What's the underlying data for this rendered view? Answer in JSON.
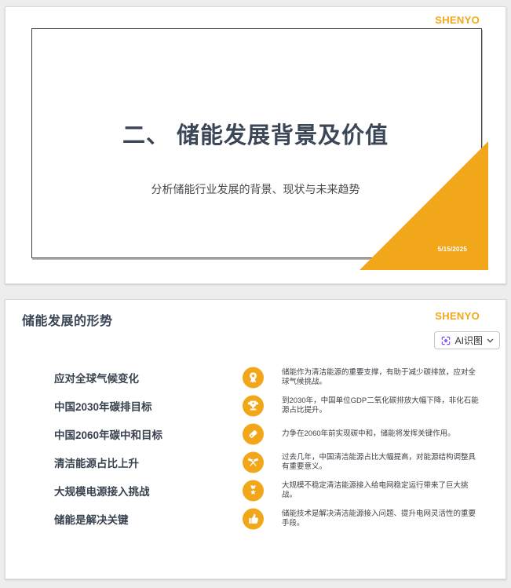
{
  "theme": {
    "accent_color": "#F2A71B",
    "title_color": "#3B4656",
    "page_background": "#EDEDEE"
  },
  "slide1": {
    "logo_text": "SHENYO",
    "title": "二、 储能发展背景及价值",
    "subtitle": "分析储能行业发展的背景、现状与未来趋势",
    "date": "5/15/2025"
  },
  "slide2": {
    "logo_text": "SHENYO",
    "title": "储能发展的形势",
    "ai_button": {
      "label": "AI识图",
      "icon": "ai-scan-icon",
      "chevron_icon": "chevron-down-icon"
    },
    "items": [
      {
        "label": "应对全球气候变化",
        "icon": "award-ribbon-icon",
        "desc": "储能作为清洁能源的重要支撑，有助于减少碳排放，应对全球气候挑战。"
      },
      {
        "label": "中国2030年碳排目标",
        "icon": "trophy-icon",
        "desc": "到2030年，中国单位GDP二氧化碳排放大幅下降，非化石能源占比提升。"
      },
      {
        "label": "中国2060年碳中和目标",
        "icon": "tag-icon",
        "desc": "力争在2060年前实现碳中和，储能将发挥关键作用。"
      },
      {
        "label": "清洁能源占比上升",
        "icon": "crossed-flags-icon",
        "desc": "过去几年，中国清洁能源占比大幅提高，对能源结构调整具有重要意义。"
      },
      {
        "label": "大规模电源接入挑战",
        "icon": "medal-icon",
        "desc": "大规模不稳定清洁能源接入给电网稳定运行带来了巨大挑战。"
      },
      {
        "label": "储能是解决关键",
        "icon": "thumbs-up-icon",
        "desc": "储能技术是解决清洁能源接入问题、提升电网灵活性的重要手段。"
      }
    ]
  }
}
